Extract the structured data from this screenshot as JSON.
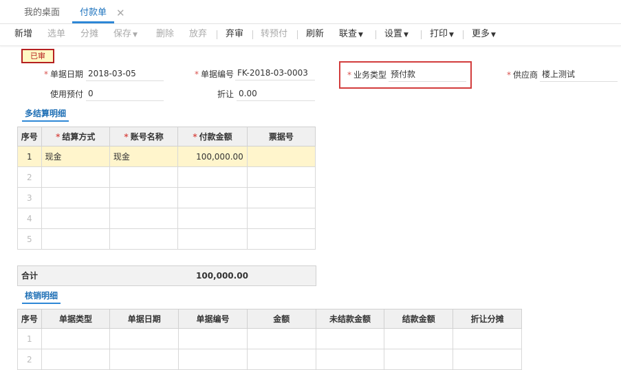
{
  "tabs": [
    {
      "label": "我的桌面"
    },
    {
      "label": "付款单"
    }
  ],
  "toolbar": {
    "new": "新增",
    "select": "选单",
    "split": "分摊",
    "save": "保存",
    "delete": "删除",
    "discard": "放弃",
    "unaudit": "弃审",
    "to_prepay": "转预付",
    "refresh": "刷新",
    "linked_query": "联查",
    "settings": "设置",
    "print": "打印",
    "more": "更多"
  },
  "status_badge": "已审",
  "form": {
    "doc_date_label": "单据日期",
    "doc_date": "2018-03-05",
    "doc_no_label": "单据编号",
    "doc_no": "FK-2018-03-0003",
    "biz_type_label": "业务类型",
    "biz_type": "预付款",
    "supplier_label": "供应商",
    "supplier": "楼上测试",
    "use_prepay_label": "使用预付",
    "use_prepay": "0",
    "discount_label": "折让",
    "discount": "0.00"
  },
  "settlement": {
    "title": "多结算明细",
    "columns": [
      "序号",
      "结算方式",
      "账号名称",
      "付款金额",
      "票据号"
    ],
    "rows": [
      {
        "idx": "1",
        "method": "现金",
        "account": "现金",
        "amount": "100,000.00",
        "bill_no": ""
      },
      {
        "idx": "2",
        "method": "",
        "account": "",
        "amount": "",
        "bill_no": ""
      },
      {
        "idx": "3",
        "method": "",
        "account": "",
        "amount": "",
        "bill_no": ""
      },
      {
        "idx": "4",
        "method": "",
        "account": "",
        "amount": "",
        "bill_no": ""
      },
      {
        "idx": "5",
        "method": "",
        "account": "",
        "amount": "",
        "bill_no": ""
      }
    ],
    "total_label": "合计",
    "total_amount": "100,000.00"
  },
  "writeoff": {
    "title": "核销明细",
    "columns": [
      "序号",
      "单据类型",
      "单据日期",
      "单据编号",
      "金额",
      "未结款金额",
      "结款金额",
      "折让分摊"
    ],
    "rows": [
      {
        "idx": "1"
      },
      {
        "idx": "2"
      }
    ]
  },
  "colors": {
    "accent": "#2d87d6",
    "required": "#d9534f",
    "highlight_box": "#d23b3b",
    "selected_row": "#fff5cc"
  }
}
